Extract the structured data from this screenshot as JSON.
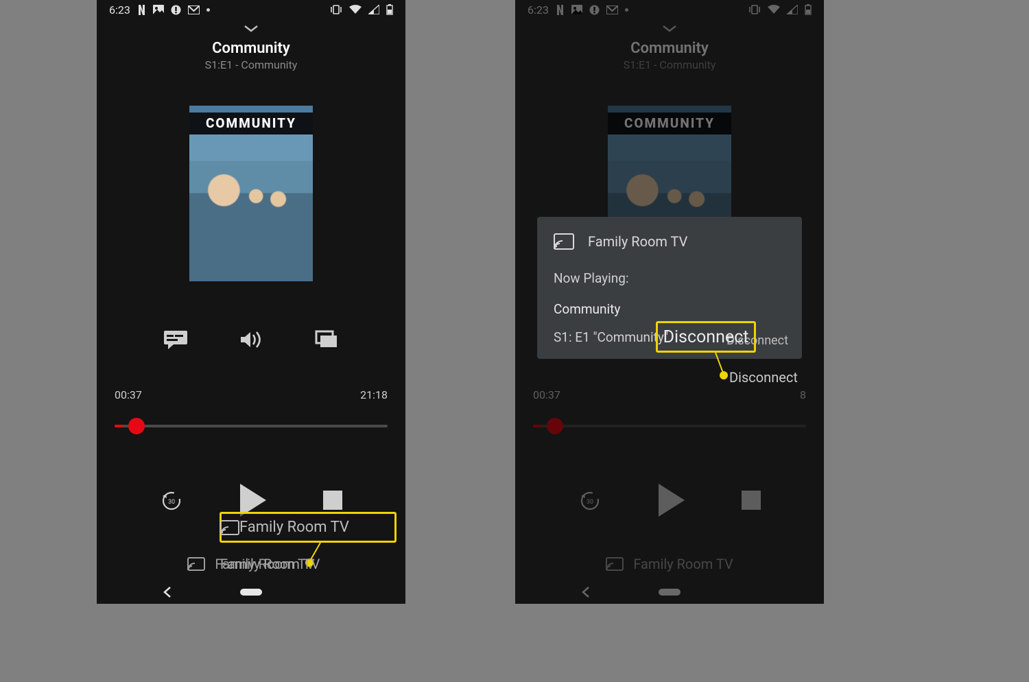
{
  "status": {
    "time": "6:23"
  },
  "header": {
    "show": "Community",
    "episode": "S1:E1 - Community"
  },
  "poster": {
    "title": "COMMUNITY"
  },
  "progress": {
    "elapsed": "00:37",
    "duration": "21:18",
    "pct": 3,
    "right_duration_hidden": "8"
  },
  "cast_bar": {
    "device": "Family Room TV"
  },
  "callout1": {
    "label": "Family Room TV"
  },
  "dialog": {
    "device": "Family Room TV",
    "now_playing_label": "Now Playing:",
    "show": "Community",
    "episode": "S1: E1 \"Community\"",
    "disconnect": "Disconnect"
  },
  "callout2": {
    "label": "Disconnect"
  }
}
